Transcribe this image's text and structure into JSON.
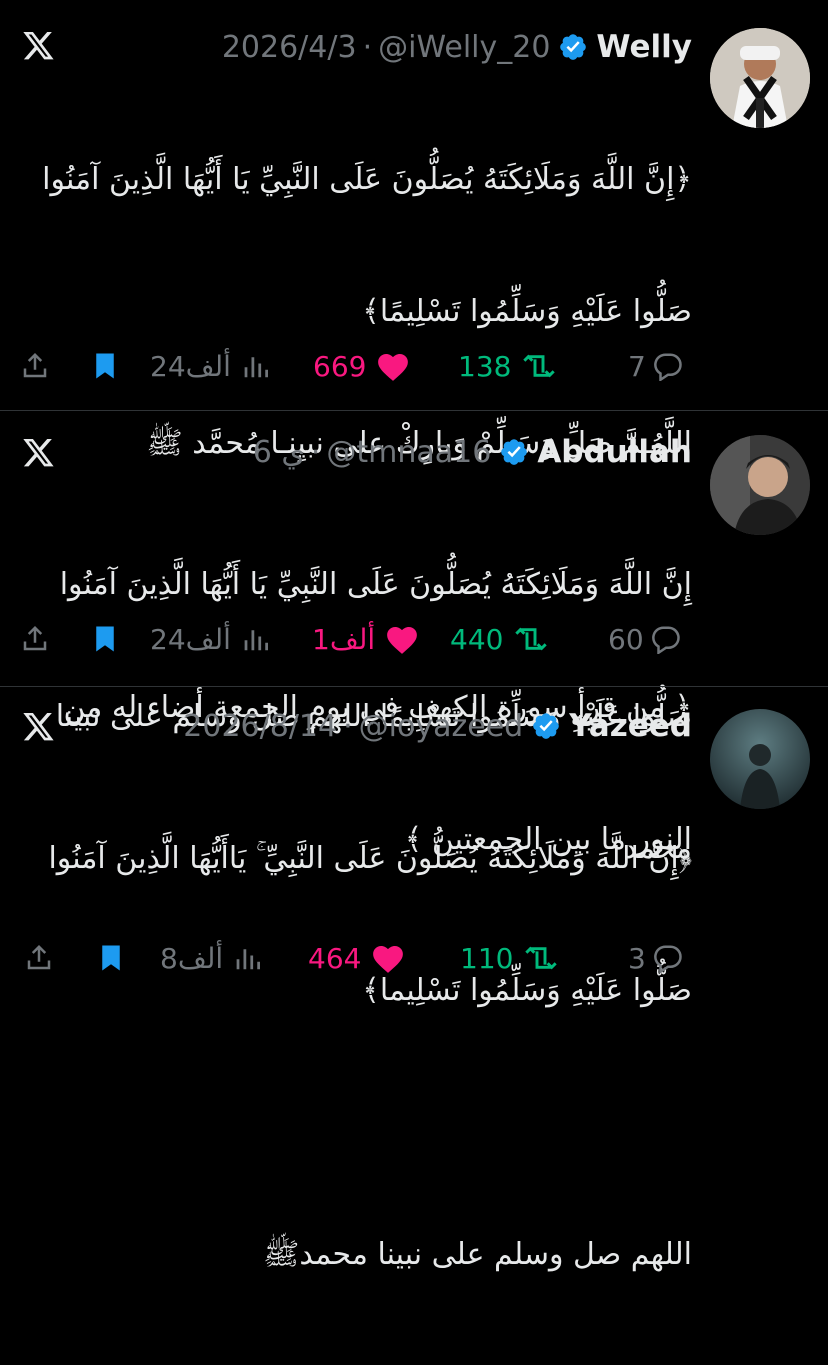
{
  "colors": {
    "background": "#000000",
    "text": "#e7e9ea",
    "muted": "#71767b",
    "like": "#f91880",
    "retweet": "#00ba7c",
    "bookmark": "#1d9bf0",
    "verified": "#1d9bf0"
  },
  "tweets": [
    {
      "name": "Welly",
      "handle": "@iWelly_20",
      "date": "2026/4/3",
      "lines": [
        "﴿إِنَّ اللَّهَ وَمَلَائِكَتَهُ يُصَلُّونَ عَلَى النَّبِيِّ يَا أَيُّهَا الَّذِينَ آمَنُوا",
        "صَلُّوا عَلَيْهِ وَسَلِّمُوا تَسْلِيمًا﴾",
        "اللَّهُـمَّ صَلِّ وَسَـلِّمْ وَبارِكْ على نبيِنـا مُحمَّد ﷺ",
        "",
        "﴿ من قرأ سورة الكهف في يومِ الجمعة أضاء له من",
        "النور ما بين الجمعتين ﴾"
      ],
      "replies": "7",
      "retweets": "138",
      "likes": "669",
      "views": "24ألف"
    },
    {
      "name": "Abdullah",
      "handle": "@tmnaa16",
      "date": "6 ي",
      "lines": [
        "إِنَّ اللَّهَ وَمَلَائِكَتَهُ يُصَلُّونَ عَلَى النَّبِيِّ يَا أَيُّهَا الَّذِينَ آمَنُوا",
        "صَلُّوا عَلَيْهِ وَسَلِّمُوا تَسْلِيمًا اللهم صل وسلم على نبينا",
        "محمد"
      ],
      "replies": "60",
      "retweets": "440",
      "likes": "1ألف",
      "views": "24ألف"
    },
    {
      "name": "Yazeed",
      "handle": "@ioyazeed",
      "date": "2026/8/14",
      "lines": [
        "﴿إِنَّ اللَّهَ وَمَلَائِكَتَهُ يُصَلُّونَ عَلَى النَّبِيِّ ۚ يَاأَيُّهَا الَّذِينَ آمَنُوا",
        "صَلُّوا عَلَيْهِ وَسَلِّمُوا تَسْلِيما﴾",
        "",
        "اللهم صل وسلم على نبينا محمدﷺ"
      ],
      "replies": "3",
      "retweets": "110",
      "likes": "464",
      "views": "8ألف"
    }
  ]
}
